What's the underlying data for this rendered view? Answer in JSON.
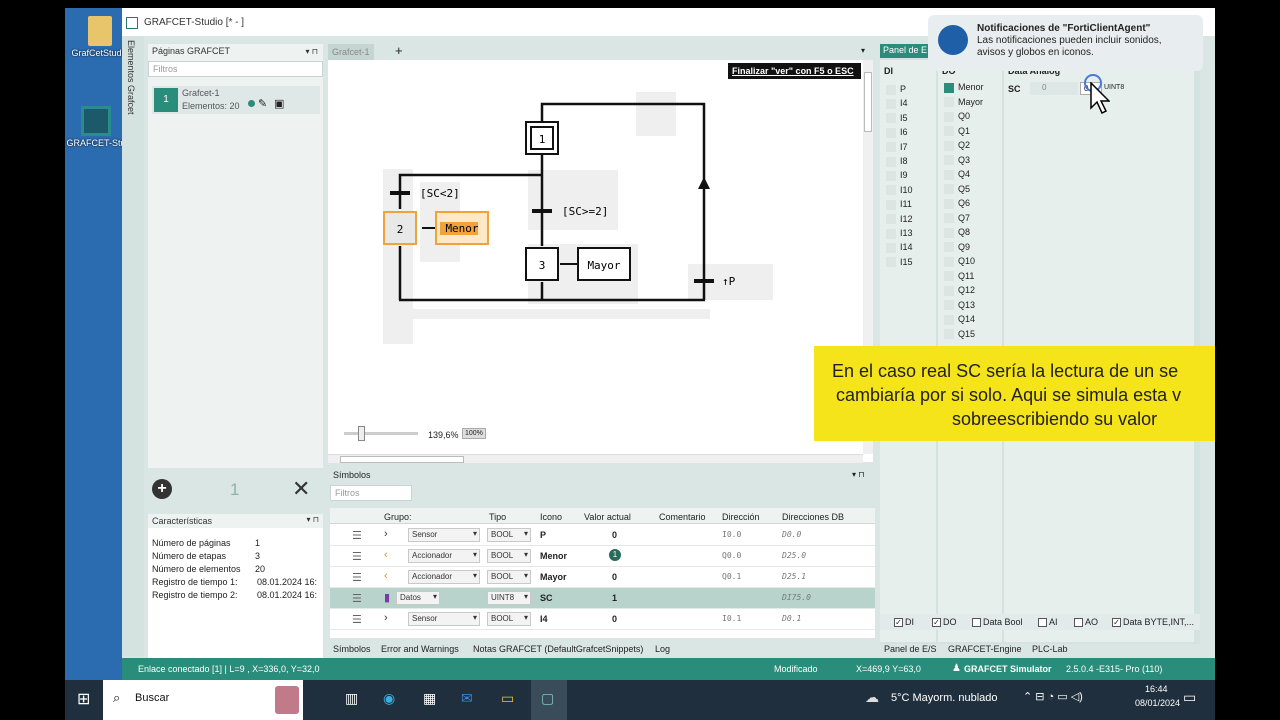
{
  "desktop": {
    "icons": [
      {
        "label": "GrafCetStudio"
      },
      {
        "label": "GRAFCET-Stu"
      }
    ]
  },
  "window": {
    "title": "GRAFCET-Studio [* - ]"
  },
  "vertical_tabs": [
    "Elementos Grafcet"
  ],
  "pages_panel": {
    "title": "Páginas GRAFCET",
    "filter_placeholder": "Filtros",
    "item": {
      "number": "1",
      "name": "Grafcet-1",
      "elements": "Elementos: 20"
    }
  },
  "pages_toolbar": {
    "count": "1"
  },
  "characteristics": {
    "title": "Características",
    "rows": [
      {
        "label": "Número de páginas",
        "value": "1"
      },
      {
        "label": "Número de etapas",
        "value": "3"
      },
      {
        "label": "Número de elementos",
        "value": "20"
      },
      {
        "label": "Registro de tiempo 1:",
        "value": "08.01.2024 16:"
      },
      {
        "label": "Registro de tiempo 2:",
        "value": "08.01.2024 16:"
      }
    ]
  },
  "editor": {
    "tab": "Grafcet-1",
    "hint": "Finalizar \"ver\" con F5 o ESC",
    "zoom": "139,6%",
    "zoom_reset": "100%",
    "steps": {
      "s1": "1",
      "s2": "2",
      "s3": "3"
    },
    "actions": {
      "a2": "Menor",
      "a3": "Mayor"
    },
    "transitions": {
      "t1": "[SC<2]",
      "t2": "[SC>=2]",
      "t3": "↑P"
    }
  },
  "symbols": {
    "title": "Símbolos",
    "filter_placeholder": "Filtros",
    "columns": [
      "Grupo:",
      "Tipo",
      "Icono",
      "Valor actual",
      "Comentario",
      "Dirección",
      "Direcciones DB"
    ],
    "rows": [
      {
        "grupo": "Sensor",
        "tipo": "BOOL",
        "icono": "P",
        "valor": "0",
        "dir": "I0.0",
        "db": "D0.0"
      },
      {
        "grupo": "Accionador",
        "tipo": "BOOL",
        "icono": "Menor",
        "valor": "1",
        "dir": "Q0.0",
        "db": "D25.0"
      },
      {
        "grupo": "Accionador",
        "tipo": "BOOL",
        "icono": "Mayor",
        "valor": "0",
        "dir": "Q0.1",
        "db": "D25.1"
      },
      {
        "grupo": "Datos",
        "tipo": "UINT8",
        "icono": "SC",
        "valor": "1",
        "dir": "",
        "db": "DI75.0"
      },
      {
        "grupo": "Sensor",
        "tipo": "BOOL",
        "icono": "I4",
        "valor": "0",
        "dir": "I0.1",
        "db": "D0.1"
      }
    ]
  },
  "bottom_tabs": [
    "Símbolos",
    "Error and Warnings",
    "Notas GRAFCET (DefaultGrafcetSnippets)",
    "Log"
  ],
  "io_panel": {
    "title": "Panel de E",
    "di_header": "DI",
    "do_header": "DO",
    "analog_header": "Data Analog",
    "di": [
      "P",
      "I4",
      "I5",
      "I6",
      "I7",
      "I8",
      "I9",
      "I10",
      "I11",
      "I12",
      "I13",
      "I14",
      "I15"
    ],
    "do": [
      "Menor",
      "Mayor",
      "Q0",
      "Q1",
      "Q2",
      "Q3",
      "Q4",
      "Q5",
      "Q6",
      "Q7",
      "Q8",
      "Q9",
      "Q10",
      "Q11",
      "Q12",
      "Q13",
      "Q14",
      "Q15"
    ],
    "analog": {
      "name": "SC",
      "value1": "0",
      "value2": "0",
      "type": "UINT8"
    },
    "checks": [
      "DI",
      "DO",
      "Data Bool",
      "AI",
      "AO",
      "Data BYTE,INT,..."
    ],
    "tabs": [
      "Panel de E/S",
      "GRAFCET-Engine",
      "PLC-Lab"
    ]
  },
  "notification": {
    "title": "Notificaciones de \"FortiClientAgent\"",
    "body": "Las notificaciones pueden incluir sonidos, avisos y globos en iconos."
  },
  "caption": {
    "line1": "En el caso real SC sería la lectura de un se",
    "line2": "cambiaría por si solo. Aqui se simula esta v",
    "line3": "sobreescribiendo su valor"
  },
  "statusbar": {
    "left": "Enlace conectado [1]  | L=9 , X=336,0, Y=32,0",
    "modified": "Modificado",
    "coords": "X=469,9  Y=63,0",
    "app": "GRAFCET Simulator",
    "version": "2.5.0.4  -E315-  Pro  (110)"
  },
  "taskbar": {
    "search": "Buscar",
    "weather": "5°C  Mayorm. nublado",
    "time": "16:44",
    "date": "08/01/2024"
  },
  "colors": {
    "accent": "#2a8c7a",
    "caption_bg": "#f5e41a",
    "active_step": "#f0a33a"
  }
}
